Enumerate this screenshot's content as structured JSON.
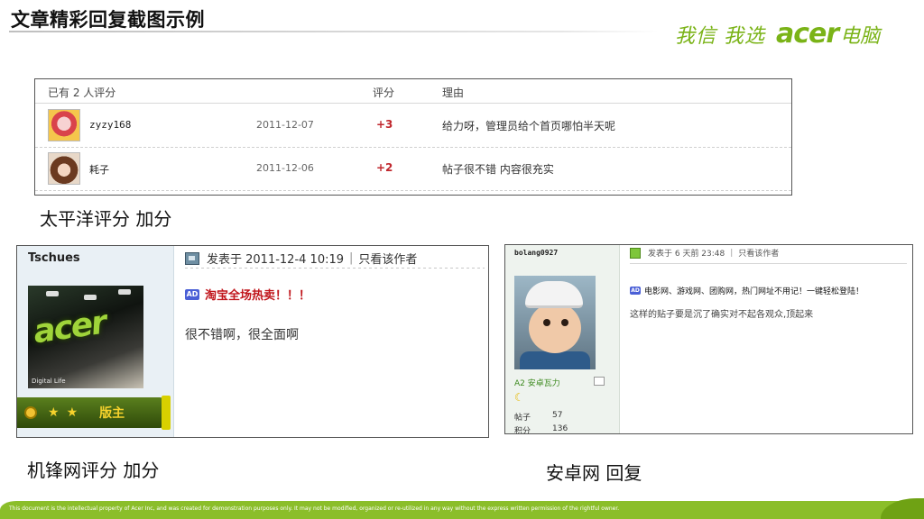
{
  "header": {
    "title": "文章精彩回复截图示例",
    "brand_slogan": "我信 我选",
    "brand_name": "acer",
    "brand_suffix": "电脑"
  },
  "rating_panel": {
    "header_rated": "已有 2 人评分",
    "header_score": "评分",
    "header_reason": "理由",
    "rows": [
      {
        "user": "zyzy168",
        "date": "2011-12-07",
        "score": "+3",
        "reason": "给力呀，管理员给个首页哪怕半天呢"
      },
      {
        "user": "耗子",
        "date": "2011-12-06",
        "score": "+2",
        "reason": "帖子很不错 内容很充实"
      }
    ]
  },
  "captions": {
    "taipingyang": "太平洋评分 加分",
    "jifeng": "机锋网评分 加分",
    "anzhuo": "安卓网 回复"
  },
  "jifeng_post": {
    "username": "Tschues",
    "avatar_logo": "acer",
    "avatar_caption": "Digital Life",
    "posted": "发表于 2011-12-4 10:19",
    "only_author": "只看该作者",
    "ad_badge": "AD",
    "ad_text": "淘宝全场热卖！！！",
    "badge_label": "版主",
    "body": "很不错啊，很全面啊"
  },
  "anzhuo_post": {
    "username": "bolang0927",
    "rank": "A2 安卓瓦力",
    "stats": [
      {
        "label": "帖子",
        "value": "57"
      },
      {
        "label": "积分",
        "value": "136"
      }
    ],
    "posted": "发表于 6 天前 23:48",
    "only_author": "只看该作者",
    "ad_badge": "AD",
    "ad_text": "电影网、游戏网、团购网，热门网址不用记！一键轻松登陆！",
    "body": "这样的贴子要是沉了确实对不起各观众,顶起来"
  },
  "footer": {
    "disclaimer": "This document is the intellectual property of Acer Inc, and was created for demonstration purposes only.  It may not be modified, organized or re-utilized in any way without the express written permission of the rightful owner."
  }
}
